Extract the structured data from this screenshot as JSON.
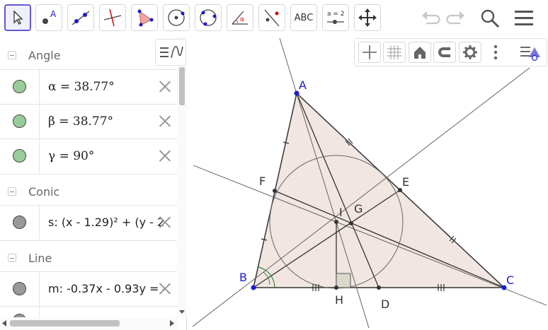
{
  "toolbar": {
    "tools": [
      {
        "name": "move-tool",
        "selected": true
      },
      {
        "name": "point-tool",
        "label": "A"
      },
      {
        "name": "line-tool"
      },
      {
        "name": "perpendicular-line-tool"
      },
      {
        "name": "polygon-tool"
      },
      {
        "name": "circle-center-point-tool"
      },
      {
        "name": "circle-three-points-tool"
      },
      {
        "name": "angle-tool"
      },
      {
        "name": "reflect-tool"
      },
      {
        "name": "text-tool",
        "label": "ABC"
      },
      {
        "name": "slider-tool",
        "label": "a = 2"
      },
      {
        "name": "move-graphics-view-tool"
      }
    ],
    "right_icons": [
      "undo-icon",
      "redo-icon",
      "search-icon",
      "menu-icon"
    ]
  },
  "algebra": {
    "groups": [
      {
        "title": "Angle"
      },
      {
        "title": "Conic"
      },
      {
        "title": "Line"
      }
    ],
    "rows": [
      {
        "text": "α = 38.77°",
        "dot_color": "#99cc99"
      },
      {
        "text": "β = 38.77°",
        "dot_color": "#99cc99"
      },
      {
        "text": "γ = 90°",
        "dot_color": "#99cc99"
      },
      {
        "text": "s: (x - 1.29)² + (y - 2",
        "dot_color": "#999999"
      },
      {
        "text": "m: -0.37x - 0.93y = -",
        "dot_color": "#999999"
      }
    ]
  },
  "graphics": {
    "points": {
      "A": "A",
      "B": "B",
      "C": "C",
      "D": "D",
      "E": "E",
      "F": "F",
      "G": "G",
      "H": "H",
      "I": "I"
    },
    "colors": {
      "triangle_fill": "#f1e6e1",
      "point_blue": "#1a1ad4",
      "point_dark": "#333333",
      "label_blue": "#1a1ad4"
    },
    "style_bar_buttons": [
      "axes-icon",
      "grid-icon",
      "home-icon",
      "magnet-icon",
      "settings-icon",
      "more-icon",
      "style-toggle-icon"
    ]
  }
}
